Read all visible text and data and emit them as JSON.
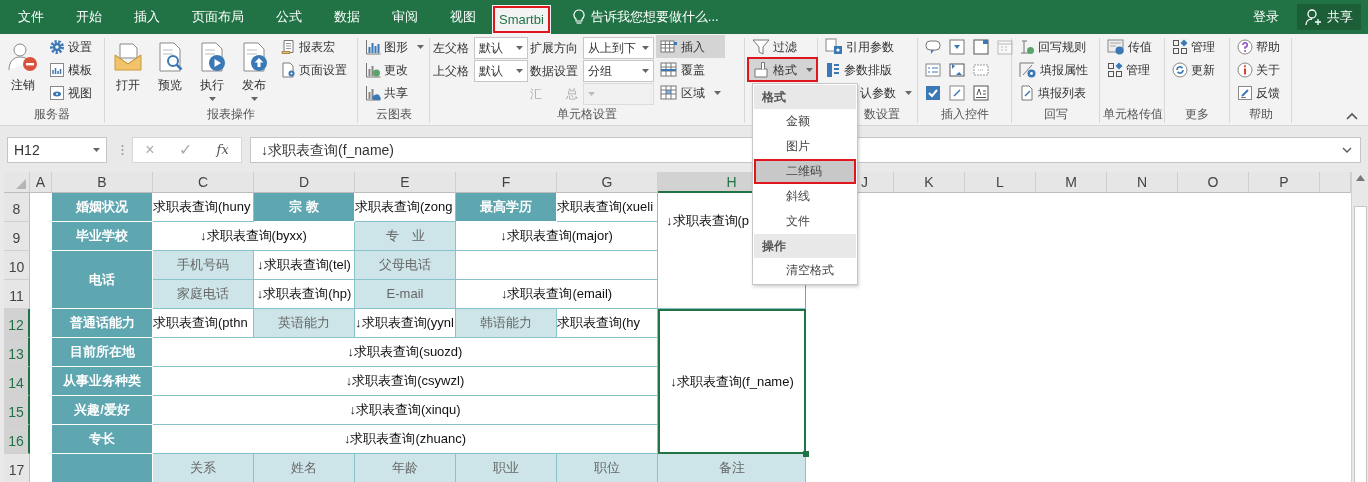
{
  "menu_tabs": [
    {
      "label": "文件",
      "selected": false,
      "highlighted": false
    },
    {
      "label": "开始",
      "selected": false,
      "highlighted": false
    },
    {
      "label": "插入",
      "selected": false,
      "highlighted": false
    },
    {
      "label": "页面布局",
      "selected": false,
      "highlighted": false
    },
    {
      "label": "公式",
      "selected": false,
      "highlighted": false
    },
    {
      "label": "数据",
      "selected": false,
      "highlighted": false
    },
    {
      "label": "审阅",
      "selected": false,
      "highlighted": false
    },
    {
      "label": "视图",
      "selected": false,
      "highlighted": false
    },
    {
      "label": "Smartbi",
      "selected": true,
      "highlighted": true
    }
  ],
  "tell_me": {
    "placeholder": "告诉我您想要做什么..."
  },
  "account": {
    "sign_in": "登录",
    "share": "共享"
  },
  "ribbon_groups": [
    {
      "label": "服务器",
      "columns": [
        [
          {
            "kind": "large",
            "label": "注销"
          }
        ],
        [
          {
            "kind": "small",
            "label": "设置"
          },
          {
            "kind": "small",
            "label": "模板"
          },
          {
            "kind": "small",
            "label": "视图"
          }
        ]
      ]
    },
    {
      "label": "报表操作",
      "columns": [
        [
          {
            "kind": "large",
            "label": "打开"
          }
        ],
        [
          {
            "kind": "large",
            "label": "预览"
          }
        ],
        [
          {
            "kind": "large",
            "label": "执行",
            "dropdown": true
          }
        ],
        [
          {
            "kind": "large",
            "label": "发布",
            "dropdown": true
          }
        ],
        [
          {
            "kind": "small",
            "label": "报表宏"
          },
          {
            "kind": "small",
            "label": "页面设置"
          }
        ]
      ]
    },
    {
      "label": "云图表",
      "columns": [
        [
          {
            "kind": "small",
            "label": "图形",
            "dropdown": true
          },
          {
            "kind": "small",
            "label": "更改"
          },
          {
            "kind": "small",
            "label": "共享"
          }
        ]
      ]
    },
    {
      "label": "单元格设置",
      "columns": [
        [
          {
            "kind": "field",
            "label": "左父格",
            "value": "默认",
            "disabled": false
          },
          {
            "kind": "field",
            "label": "上父格",
            "value": "默认",
            "disabled": false
          }
        ],
        [
          {
            "kind": "field",
            "label": "扩展方向",
            "value": "从上到下",
            "disabled": false
          },
          {
            "kind": "field",
            "label": "数据设置",
            "value": "分组",
            "disabled": false
          },
          {
            "kind": "field",
            "label": "汇　　总",
            "disabled": true
          }
        ],
        [
          {
            "kind": "small",
            "label": "插入",
            "pressed": true
          },
          {
            "kind": "small",
            "label": "覆盖",
            "pressed": false
          },
          {
            "kind": "small",
            "label": "区域",
            "pressed": false,
            "dropdown": true
          }
        ]
      ]
    },
    {
      "columns": [
        [
          {
            "kind": "small",
            "label": "过滤",
            "pressed": false,
            "highlighted": false
          },
          {
            "kind": "small",
            "label": "格式",
            "pressed": true,
            "highlighted": true,
            "dropdown": true
          }
        ]
      ]
    },
    {
      "label": "数设置",
      "columns": [
        [
          {
            "kind": "small",
            "label": "引用参数"
          },
          {
            "kind": "small",
            "label": "参数排版"
          },
          {
            "kind": "text",
            "label": "认参数",
            "dropdown": true
          }
        ]
      ]
    },
    {
      "label": "插入控件",
      "columns": [
        [
          {
            "kind": "iconrow",
            "icons": [
              {
                "disabled": false
              },
              {
                "disabled": false
              },
              {
                "disabled": false
              },
              {
                "disabled": true
              }
            ]
          },
          {
            "kind": "iconrow",
            "icons": [
              {
                "disabled": false
              },
              {
                "disabled": false
              },
              {
                "disabled": false
              }
            ]
          },
          {
            "kind": "iconrow",
            "icons": [
              {
                "disabled": false
              },
              {
                "disabled": false
              },
              {
                "disabled": false
              }
            ]
          }
        ]
      ]
    },
    {
      "label": "回写",
      "columns": [
        [
          {
            "kind": "small",
            "label": "回写规则"
          },
          {
            "kind": "small",
            "label": "填报属性"
          },
          {
            "kind": "small",
            "label": "填报列表"
          }
        ]
      ]
    },
    {
      "label": "单元格传值",
      "columns": [
        [
          {
            "kind": "small",
            "label": "传值"
          },
          {
            "kind": "small",
            "label": "管理"
          }
        ]
      ]
    },
    {
      "label": "更多",
      "columns": [
        [
          {
            "kind": "small",
            "label": "管理"
          },
          {
            "kind": "small",
            "label": "更新"
          }
        ]
      ]
    },
    {
      "label": "帮助",
      "columns": [
        [
          {
            "kind": "small",
            "label": "帮助"
          },
          {
            "kind": "small",
            "label": "关于"
          },
          {
            "kind": "small",
            "label": "反馈"
          }
        ]
      ]
    }
  ],
  "formula_bar": {
    "name_box": "H12",
    "cancel": "×",
    "enter": "✓",
    "function": "fx",
    "formula": "↓求职表查询(f_name)"
  },
  "sheet": {
    "columns": [
      {
        "label": "A",
        "selected": false
      },
      {
        "label": "B",
        "selected": false
      },
      {
        "label": "C",
        "selected": false
      },
      {
        "label": "D",
        "selected": false
      },
      {
        "label": "E",
        "selected": false
      },
      {
        "label": "F",
        "selected": false
      },
      {
        "label": "G",
        "selected": false
      },
      {
        "label": "H",
        "selected": true
      },
      {
        "label": "J",
        "selected": false
      },
      {
        "label": "K",
        "selected": false
      },
      {
        "label": "L",
        "selected": false
      },
      {
        "label": "M",
        "selected": false
      },
      {
        "label": "N",
        "selected": false
      },
      {
        "label": "O",
        "selected": false
      },
      {
        "label": "P",
        "selected": false
      }
    ],
    "rows": [
      {
        "label": "8",
        "selected": false
      },
      {
        "label": "9",
        "selected": false
      },
      {
        "label": "10",
        "selected": false
      },
      {
        "label": "11",
        "selected": false
      },
      {
        "label": "12",
        "selected": true
      },
      {
        "label": "13",
        "selected": true
      },
      {
        "label": "14",
        "selected": true
      },
      {
        "label": "15",
        "selected": true
      },
      {
        "label": "16",
        "selected": true
      },
      {
        "label": "17",
        "selected": false
      }
    ],
    "cells": [
      {
        "kind": "header",
        "text": "婚姻状况"
      },
      {
        "kind": "value",
        "text": "求职表查询(huny"
      },
      {
        "kind": "header",
        "text": "宗 教"
      },
      {
        "kind": "value",
        "text": "求职表查询(zong"
      },
      {
        "kind": "header",
        "text": "最高学历"
      },
      {
        "kind": "value",
        "text": "求职表查询(xueli"
      },
      {
        "kind": "value",
        "text": "↓求职表查询(p"
      },
      {
        "kind": "header",
        "text": "毕业学校"
      },
      {
        "kind": "value",
        "text": "↓求职表查询(byxx)"
      },
      {
        "kind": "label",
        "text": "专　业"
      },
      {
        "kind": "value",
        "text": "↓求职表查询(major)"
      },
      {
        "kind": "header",
        "text": "电话"
      },
      {
        "kind": "label",
        "text": "手机号码"
      },
      {
        "kind": "value",
        "text": "↓求职表查询(tel)"
      },
      {
        "kind": "label",
        "text": "父母电话"
      },
      {
        "kind": "value"
      },
      {
        "kind": "label",
        "text": "家庭电话"
      },
      {
        "kind": "value",
        "text": "↓求职表查询(hp)"
      },
      {
        "kind": "label",
        "text": "E-mail"
      },
      {
        "kind": "value",
        "text": "↓求职表查询(email)"
      },
      {
        "kind": "header",
        "text": "普通话能力"
      },
      {
        "kind": "value",
        "text": "求职表查询(pthn"
      },
      {
        "kind": "label",
        "text": "英语能力"
      },
      {
        "kind": "value",
        "text": "↓求职表查询(yynl"
      },
      {
        "kind": "label",
        "text": "韩语能力"
      },
      {
        "kind": "value",
        "text": "求职表查询(hy"
      },
      {
        "kind": "value",
        "text": "↓求职表查询(f_name)",
        "selected": true
      },
      {
        "kind": "header",
        "text": "目前所在地"
      },
      {
        "kind": "value",
        "text": "↓求职表查询(suozd)"
      },
      {
        "kind": "header",
        "text": "从事业务种类"
      },
      {
        "kind": "value",
        "text": "↓求职表查询(csywzl)"
      },
      {
        "kind": "header",
        "text": "兴趣/爱好"
      },
      {
        "kind": "value",
        "text": "↓求职表查询(xinqu)"
      },
      {
        "kind": "header",
        "text": "专长"
      },
      {
        "kind": "value",
        "text": "↓求职表查询(zhuanc)"
      },
      {
        "kind": "header"
      },
      {
        "kind": "label",
        "text": "关系"
      },
      {
        "kind": "label",
        "text": "姓名"
      },
      {
        "kind": "label",
        "text": "年龄"
      },
      {
        "kind": "label",
        "text": "职业"
      },
      {
        "kind": "label",
        "text": "职位"
      },
      {
        "kind": "label",
        "text": "备注"
      }
    ]
  },
  "format_menu": {
    "items": [
      {
        "kind": "header",
        "label": "格式"
      },
      {
        "kind": "item",
        "label": "金额",
        "selected": false,
        "highlighted": false
      },
      {
        "kind": "item",
        "label": "图片",
        "selected": false,
        "highlighted": false
      },
      {
        "kind": "item",
        "label": "二维码",
        "selected": true,
        "highlighted": true
      },
      {
        "kind": "item",
        "label": "斜线",
        "selected": false,
        "highlighted": false
      },
      {
        "kind": "item",
        "label": "文件",
        "selected": false,
        "highlighted": false
      },
      {
        "kind": "header",
        "label": "操作"
      },
      {
        "kind": "item",
        "label": "清空格式",
        "selected": false,
        "highlighted": false
      }
    ]
  }
}
